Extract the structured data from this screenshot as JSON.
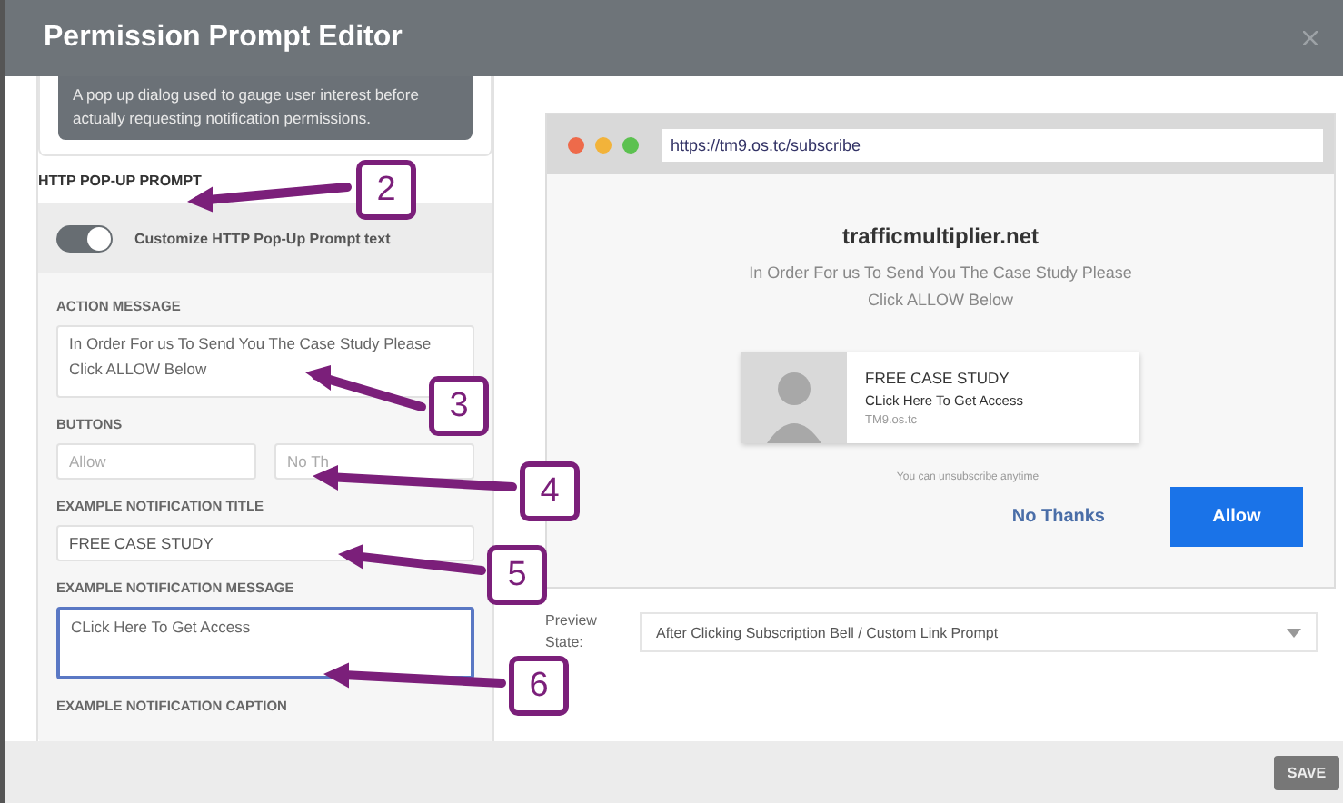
{
  "window": {
    "title": "Permission Prompt Editor"
  },
  "info_card": {
    "description": "A pop up dialog used to gauge user interest before actually requesting notification permissions."
  },
  "section_heading": "HTTP POP-UP PROMPT",
  "toggle": {
    "label": "Customize HTTP Pop-Up Prompt text",
    "on": true
  },
  "fields": [
    {
      "label": "ACTION MESSAGE",
      "kind": "textarea",
      "value": "In Order For us To Send You The Case Study Please Click ALLOW Below",
      "focused": false
    },
    {
      "label": "BUTTONS",
      "kind": "pair",
      "placeholders": [
        "Allow",
        "No Th"
      ]
    },
    {
      "label": "EXAMPLE NOTIFICATION TITLE",
      "kind": "input",
      "value": "FREE CASE STUDY",
      "focused": false
    },
    {
      "label": "EXAMPLE NOTIFICATION MESSAGE",
      "kind": "textarea",
      "value": "CLick Here To Get Access",
      "focused": true
    },
    {
      "label": "EXAMPLE NOTIFICATION CAPTION",
      "kind": "heading"
    }
  ],
  "preview": {
    "url": "https://tm9.os.tc/subscribe",
    "site": "trafficmultiplier.net",
    "message": "In Order For us To Send You The Case Study Please Click ALLOW Below",
    "notification": {
      "title": "FREE CASE STUDY",
      "message": "CLick Here To Get Access",
      "domain": "TM9.os.tc"
    },
    "note": "You can unsubscribe anytime",
    "buttons": [
      {
        "label": "No Thanks",
        "kind": "text"
      },
      {
        "label": "Allow",
        "kind": "primary"
      }
    ]
  },
  "preview_state": {
    "label": "Preview State:",
    "value": "After Clicking Subscription Bell / Custom Link Prompt"
  },
  "footer": {
    "save": "SAVE"
  },
  "callouts": [
    "2",
    "3",
    "4",
    "5",
    "6"
  ]
}
